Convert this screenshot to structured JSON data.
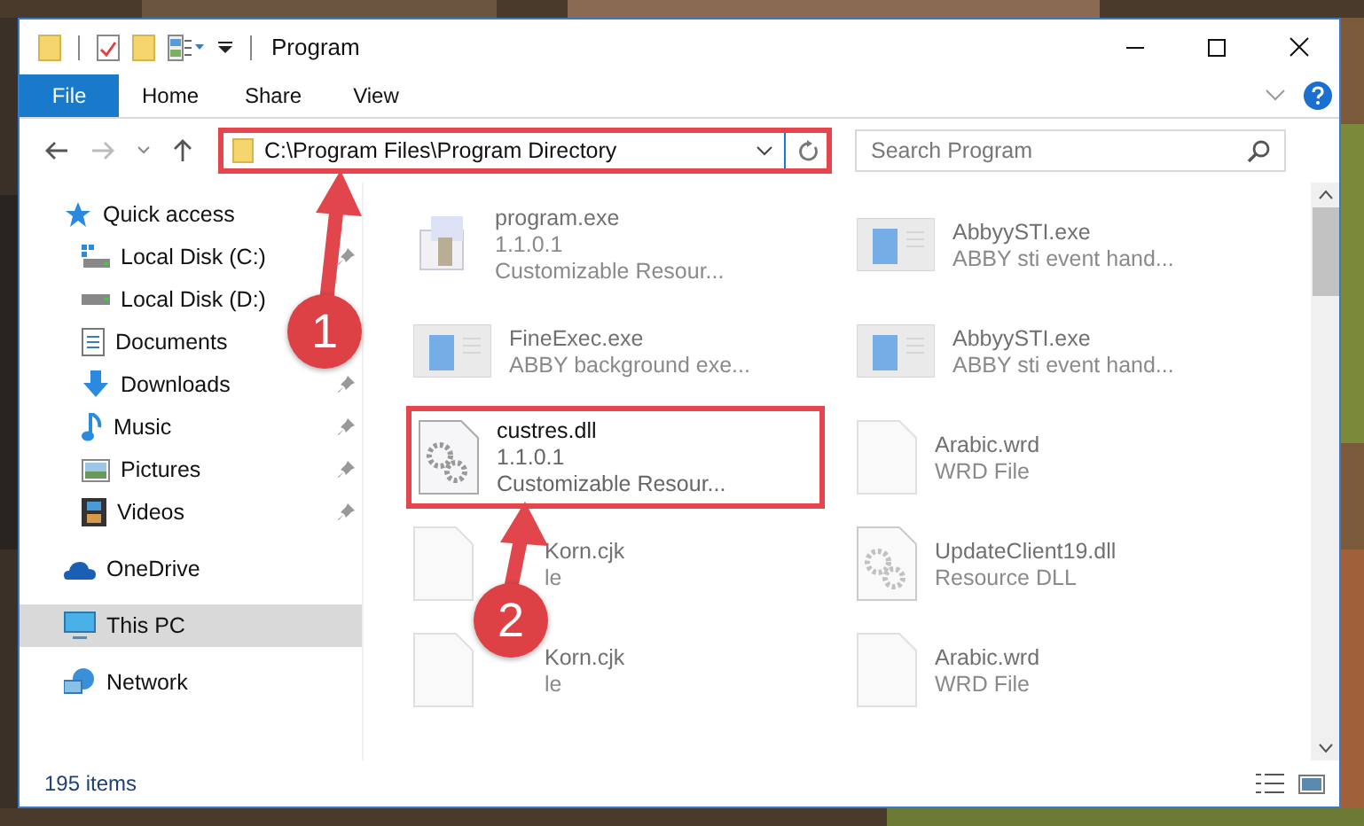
{
  "window": {
    "title": "Program"
  },
  "ribbon": {
    "tabs": [
      {
        "label": "File",
        "kind": "file"
      },
      {
        "label": "Home",
        "kind": "tab"
      },
      {
        "label": "Share",
        "kind": "tab"
      },
      {
        "label": "View",
        "kind": "tab"
      }
    ]
  },
  "address": {
    "path": "C:\\Program Files\\Program Directory",
    "highlighted": true
  },
  "search": {
    "placeholder": "Search Program"
  },
  "sidebar": {
    "items": [
      {
        "label": "Quick access",
        "kind": "star",
        "selected": false,
        "children": [
          {
            "label": "Local Disk (C:)",
            "kind": "system-drive",
            "pinned": true,
            "selected": false
          },
          {
            "label": "Local Disk (D:)",
            "kind": "drive",
            "pinned": false,
            "selected": false
          },
          {
            "label": "Documents",
            "kind": "documents",
            "pinned": false,
            "selected": false
          },
          {
            "label": "Downloads",
            "kind": "downloads",
            "pinned": true,
            "selected": false
          },
          {
            "label": "Music",
            "kind": "music",
            "pinned": true,
            "selected": false
          },
          {
            "label": "Pictures",
            "kind": "pictures",
            "pinned": true,
            "selected": false
          },
          {
            "label": "Videos",
            "kind": "videos",
            "pinned": true,
            "selected": false
          }
        ]
      },
      {
        "label": "OneDrive",
        "kind": "cloud",
        "selected": false
      },
      {
        "label": "This PC",
        "kind": "computer",
        "selected": true
      },
      {
        "label": "Network",
        "kind": "network",
        "selected": false
      }
    ]
  },
  "files": [
    {
      "name": "program.exe",
      "details": [
        "1.1.0.1",
        "Customizable Resour..."
      ],
      "kind": "setup",
      "blurred": true,
      "highlighted": false,
      "covered": false
    },
    {
      "name": "AbbyySTI.exe",
      "details": [
        "ABBY sti event hand..."
      ],
      "kind": "app",
      "blurred": true,
      "highlighted": false,
      "covered": false
    },
    {
      "name": "FineExec.exe",
      "details": [
        "ABBY background exe..."
      ],
      "kind": "app",
      "blurred": true,
      "highlighted": false,
      "covered": false
    },
    {
      "name": "AbbyySTI.exe",
      "details": [
        "ABBY sti event hand..."
      ],
      "kind": "app",
      "blurred": true,
      "highlighted": false,
      "covered": false
    },
    {
      "name": "custres.dll",
      "details": [
        "1.1.0.1",
        "Customizable Resour..."
      ],
      "kind": "dll",
      "blurred": false,
      "highlighted": true,
      "covered": false
    },
    {
      "name": "Arabic.wrd",
      "details": [
        "WRD File"
      ],
      "kind": "file",
      "blurred": true,
      "highlighted": false,
      "covered": false
    },
    {
      "name": "Korn.cjk",
      "details": [
        "le"
      ],
      "kind": "file",
      "blurred": true,
      "highlighted": false,
      "covered": true
    },
    {
      "name": "UpdateClient19.dll",
      "details": [
        "Resource DLL"
      ],
      "kind": "dll",
      "blurred": true,
      "highlighted": false,
      "covered": false
    },
    {
      "name": "Korn.cjk",
      "details": [
        "le"
      ],
      "kind": "file",
      "blurred": true,
      "highlighted": false,
      "covered": true
    },
    {
      "name": "Arabic.wrd",
      "details": [
        "WRD File"
      ],
      "kind": "file",
      "blurred": true,
      "highlighted": false,
      "covered": false
    }
  ],
  "status_bar": {
    "count": "195 items"
  },
  "annotations": [
    {
      "number": "1"
    },
    {
      "number": "2"
    }
  ]
}
